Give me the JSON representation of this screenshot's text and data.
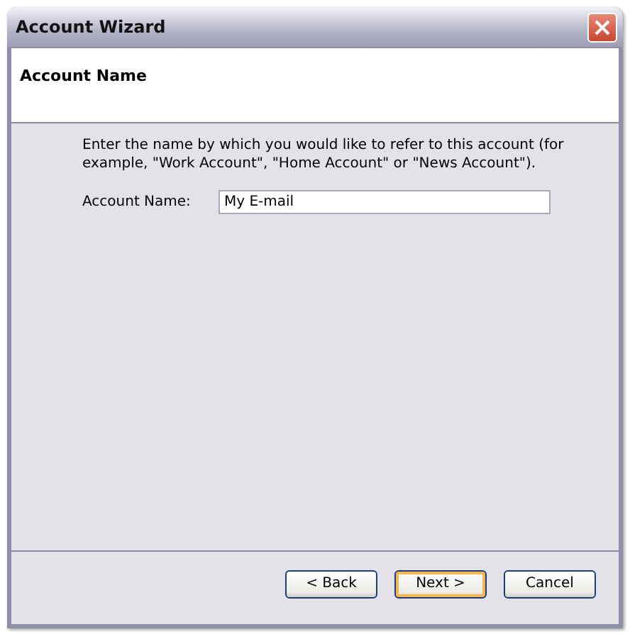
{
  "window": {
    "title": "Account Wizard"
  },
  "header": {
    "title": "Account Name"
  },
  "description": "Enter the name by which you would like to refer to this account (for example, \"Work Account\", \"Home Account\" or \"News Account\").",
  "field": {
    "label": "Account Name:",
    "value": "My E-mail"
  },
  "buttons": [
    {
      "label": "< Back",
      "default": false
    },
    {
      "label": "Next >",
      "default": true
    },
    {
      "label": "Cancel",
      "default": false
    }
  ]
}
